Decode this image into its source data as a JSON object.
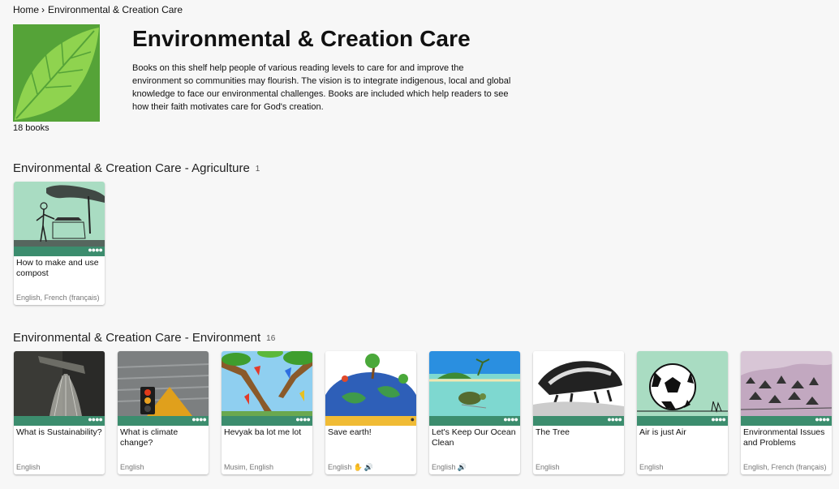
{
  "breadcrumb": {
    "home": "Home",
    "separator": "›",
    "current": "Environmental & Creation Care"
  },
  "shelf": {
    "title": "Environmental & Creation Care",
    "description": "Books on this shelf help people of various reading levels to care for and improve the environment so communities may flourish. The vision is to integrate indigenous, local and global knowledge to face our environmental challenges. Books are included which help readers to see how their faith motivates care for God's creation.",
    "book_count": "18 books",
    "image_icon": "leaf-icon"
  },
  "sections": [
    {
      "title": "Environmental & Creation Care - Agriculture",
      "count": "1",
      "books": [
        {
          "title": "How to make and use compost",
          "languages": "English, French (français)",
          "thumb": "compost-illustration"
        }
      ]
    },
    {
      "title": "Environmental & Creation Care - Environment",
      "count": "16",
      "books": [
        {
          "title": "What is Sustainability?",
          "languages": "English",
          "thumb": "watering-can-photo"
        },
        {
          "title": "What is climate change?",
          "languages": "English",
          "thumb": "flooded-traffic-light-photo"
        },
        {
          "title": "Hevyak ba lot me lot",
          "languages": "Musim, English",
          "thumb": "parrots-illustration"
        },
        {
          "title": "Save earth!",
          "languages": "English",
          "thumb": "earth-drawing",
          "audio_icons": "sign-language-icon, audio-icon"
        },
        {
          "title": "Let's Keep Our Ocean Clean",
          "languages": "English",
          "thumb": "turtle-ocean-illustration",
          "audio_icons": "audio-icon"
        },
        {
          "title": "The Tree",
          "languages": "English",
          "thumb": "honey-badger-sketch"
        },
        {
          "title": "Air is just Air",
          "languages": "English",
          "thumb": "football-illustration"
        },
        {
          "title": "Environmental Issues and Problems",
          "languages": "English, French (français)",
          "thumb": "village-sketch"
        }
      ]
    }
  ],
  "colors": {
    "card_bar": "#3c8d6e",
    "card_bar_alt": "#f0bb35",
    "shelf_green": "#55a338",
    "background": "#f7f7f7"
  }
}
